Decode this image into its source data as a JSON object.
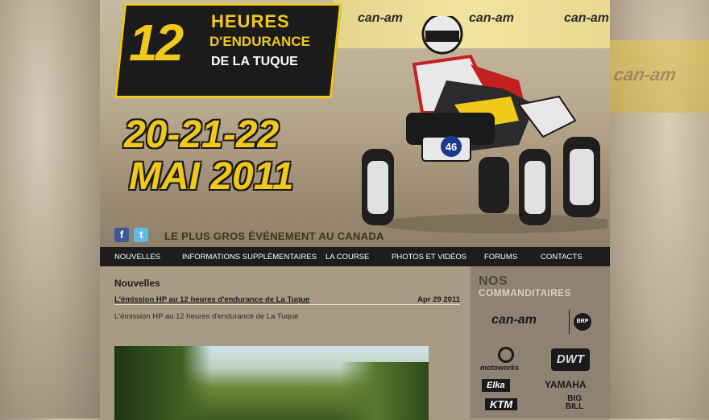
{
  "header": {
    "logo": {
      "big_number": "12",
      "line1": "HEURES",
      "line2": "D'ENDURANCE",
      "line3": "DE LA TUQUE"
    },
    "dates_line1": "20-21-22",
    "dates_line2": "MAI 2011",
    "tagline": "LE PLUS GROS ÉVÉNEMENT AU CANADA",
    "banner_brand": "can-am",
    "rider_number": "46",
    "social": {
      "facebook": "f",
      "twitter": "t"
    }
  },
  "nav": {
    "items": [
      {
        "label": "NOUVELLES"
      },
      {
        "label": "INFORMATIONS SUPPLÉMENTAIRES"
      },
      {
        "label": "LA COURSE"
      },
      {
        "label": "PHOTOS ET VIDÉOS"
      },
      {
        "label": "FORUMS"
      },
      {
        "label": "CONTACTS"
      }
    ]
  },
  "content": {
    "section_title": "Nouvelles",
    "post": {
      "title": "L'émission HP au 12 heures d'endurance de La Tuque",
      "date": "Apr 29 2011",
      "body": "L'émission HP au 12 heures d'endurance de La Tuque"
    }
  },
  "sidebar": {
    "title": "NOS",
    "subtitle": "COMMANDITAIRES",
    "sponsors": {
      "canam": "can-am",
      "brp": "BRP",
      "motoworks": "motoworks",
      "dwt": "DWT",
      "elka": "Elka",
      "yamaha": "YAMAHA",
      "ktm": "KTM",
      "bigbill_1": "BIG",
      "bigbill_2": "BILL"
    }
  },
  "background": {
    "right_ghost": "can-am"
  },
  "colors": {
    "accent_yellow": "#f2c81a",
    "nav_bg": "#1d1d1d",
    "content_bg": "#a89a84"
  }
}
